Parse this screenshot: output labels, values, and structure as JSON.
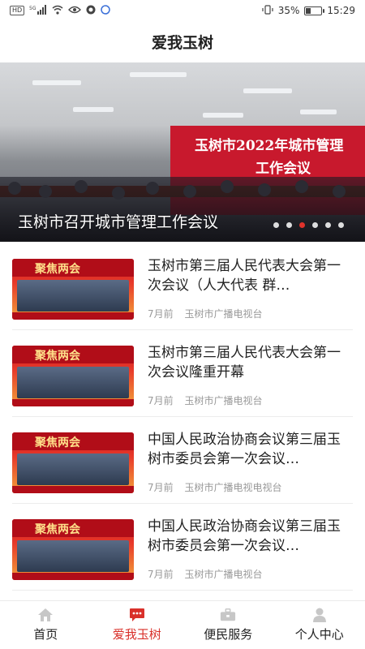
{
  "status_bar": {
    "hd_badge": "HD",
    "signal_label": "5G",
    "battery_level": "35%",
    "battery_fraction": 0.35,
    "time": "15:29"
  },
  "header": {
    "title": "爱我玉树"
  },
  "banner": {
    "backdrop_line1": "玉树市2022年城市管理",
    "backdrop_line2": "工作会议",
    "caption": "玉树市召开城市管理工作会议",
    "dot_count": 6,
    "active_dot": 2
  },
  "news": [
    {
      "thumb_text": "聚焦两会",
      "title": "玉树市第三届人民代表大会第一次会议（人大代表 群…",
      "time": "7月前",
      "source": "玉树市广播电视台"
    },
    {
      "thumb_text": "聚焦两会",
      "title": "玉树市第三届人民代表大会第一次会议隆重开幕",
      "time": "7月前",
      "source": "玉树市广播电视台"
    },
    {
      "thumb_text": "聚焦两会",
      "title": "中国人民政治协商会议第三届玉树市委员会第一次会议…",
      "time": "7月前",
      "source": "玉树市广播电视电视台"
    },
    {
      "thumb_text": "聚焦两会",
      "title": "中国人民政治协商会议第三届玉树市委员会第一次会议…",
      "time": "7月前",
      "source": "玉树市广播电视台"
    }
  ],
  "tabs": [
    {
      "label": "首页",
      "icon": "home-icon",
      "active": false
    },
    {
      "label": "爱我玉树",
      "icon": "chat-icon",
      "active": true
    },
    {
      "label": "便民服务",
      "icon": "briefcase-icon",
      "active": false
    },
    {
      "label": "个人中心",
      "icon": "person-icon",
      "active": false
    }
  ],
  "colors": {
    "accent": "#d9302a",
    "inactive_icon": "#c7c7c7"
  }
}
